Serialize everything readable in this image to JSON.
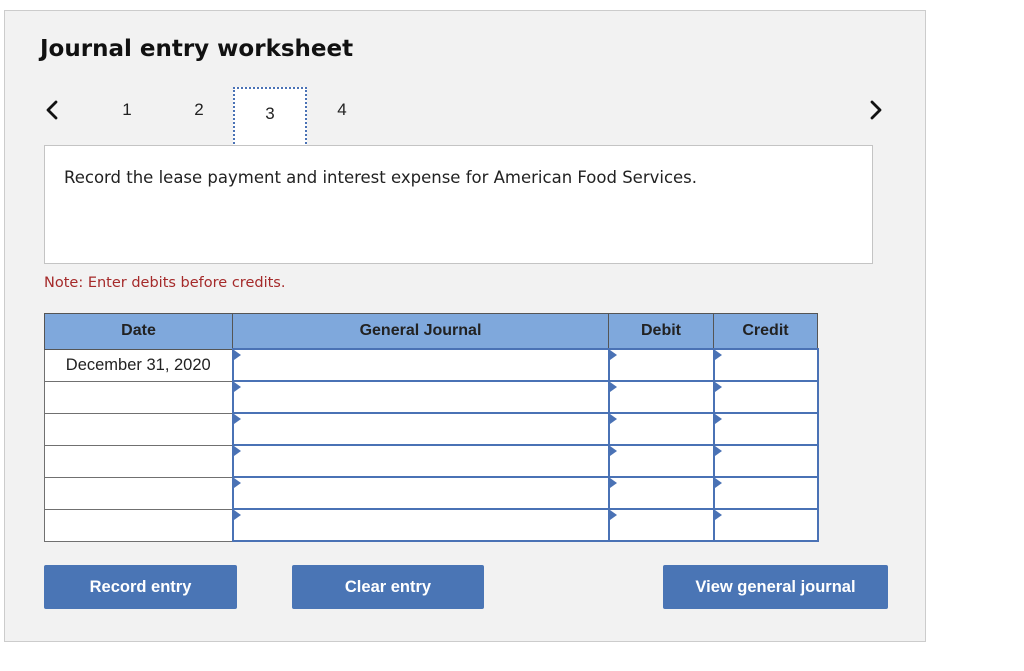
{
  "header": {
    "title": "Journal entry worksheet"
  },
  "pagination": {
    "prev_icon": "chevron-left-icon",
    "next_icon": "chevron-right-icon",
    "steps": [
      "1",
      "2",
      "3",
      "4"
    ],
    "active_step": "3"
  },
  "prompt": {
    "text": "Record the lease payment and interest expense for American Food Services."
  },
  "note": "Note: Enter debits before credits.",
  "table": {
    "columns": [
      "Date",
      "General Journal",
      "Debit",
      "Credit"
    ],
    "rows": [
      {
        "date": "December 31, 2020",
        "account": "",
        "debit": "",
        "credit": ""
      },
      {
        "date": "",
        "account": "",
        "debit": "",
        "credit": ""
      },
      {
        "date": "",
        "account": "",
        "debit": "",
        "credit": ""
      },
      {
        "date": "",
        "account": "",
        "debit": "",
        "credit": ""
      },
      {
        "date": "",
        "account": "",
        "debit": "",
        "credit": ""
      },
      {
        "date": "",
        "account": "",
        "debit": "",
        "credit": ""
      }
    ]
  },
  "buttons": {
    "record": "Record entry",
    "clear": "Clear entry",
    "view": "View general journal"
  },
  "colors": {
    "accent": "#4a75b5",
    "header_bg": "#7fa8dc",
    "note": "#a52a2a",
    "panel_bg": "#f2f2f2"
  }
}
